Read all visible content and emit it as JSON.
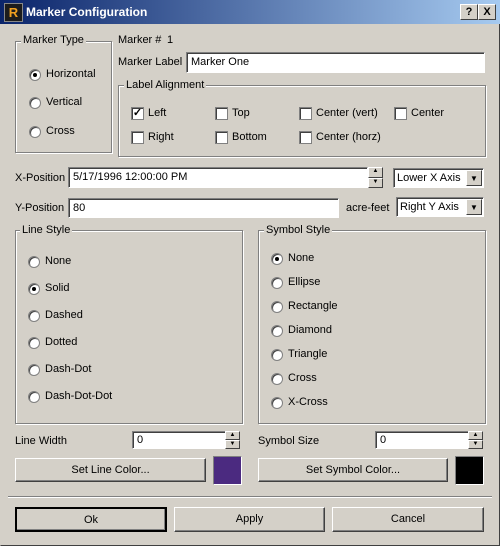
{
  "window": {
    "title": "Marker Configuration",
    "help_label": "?",
    "close_label": "X"
  },
  "marker_type": {
    "legend": "Marker Type",
    "options": [
      "Horizontal",
      "Vertical",
      "Cross"
    ],
    "selected": "Horizontal"
  },
  "marker": {
    "number_label": "Marker #",
    "number_value": "1",
    "label_caption": "Marker Label",
    "label_value": "Marker One"
  },
  "label_alignment": {
    "legend": "Label Alignment",
    "options": [
      "Left",
      "Top",
      "Center (vert)",
      "Center",
      "Right",
      "Bottom",
      "Center (horz)"
    ],
    "checked": [
      "Left"
    ]
  },
  "position": {
    "x_label": "X-Position",
    "x_value": "5/17/1996 12:00:00 PM",
    "x_axis": "Lower X Axis",
    "y_label": "Y-Position",
    "y_value": "80",
    "y_units": "acre-feet",
    "y_axis": "Right Y Axis"
  },
  "line_style": {
    "legend": "Line Style",
    "options": [
      "None",
      "Solid",
      "Dashed",
      "Dotted",
      "Dash-Dot",
      "Dash-Dot-Dot"
    ],
    "selected": "Solid",
    "width_label": "Line Width",
    "width_value": "0",
    "color_button": "Set Line Color...",
    "color": "#4b2a80"
  },
  "symbol_style": {
    "legend": "Symbol Style",
    "options": [
      "None",
      "Ellipse",
      "Rectangle",
      "Diamond",
      "Triangle",
      "Cross",
      "X-Cross"
    ],
    "selected": "None",
    "size_label": "Symbol Size",
    "size_value": "0",
    "color_button": "Set Symbol Color...",
    "color": "#000000"
  },
  "buttons": {
    "ok": "Ok",
    "apply": "Apply",
    "cancel": "Cancel"
  }
}
